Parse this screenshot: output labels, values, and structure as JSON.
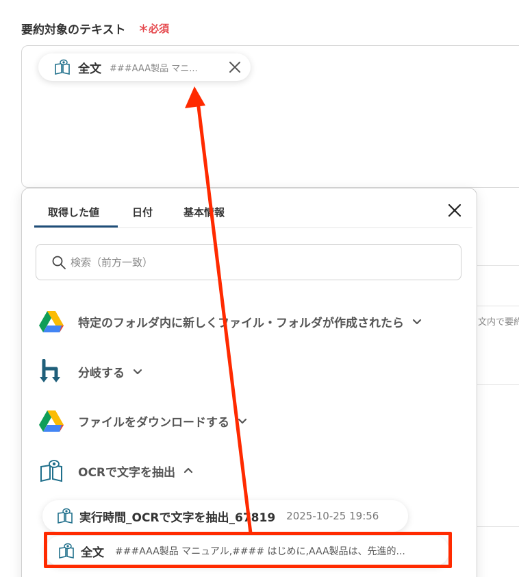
{
  "field": {
    "label": "要約対象のテキスト",
    "required": "＊必須"
  },
  "chip": {
    "icon": "book-eye-icon",
    "title": "全文",
    "preview": "###AAA製品 マニ..."
  },
  "background": {
    "partial_text": "文内で要約"
  },
  "panel": {
    "tabs": [
      {
        "label": "取得した値",
        "active": true
      },
      {
        "label": "日付",
        "active": false
      },
      {
        "label": "基本情報",
        "active": false
      }
    ],
    "search": {
      "placeholder": "検索（前方一致）"
    },
    "steps": [
      {
        "icon": "google-drive-icon",
        "label": "特定のフォルダ内に新しくファイル・フォルダが作成されたら",
        "expanded": false
      },
      {
        "icon": "branch-icon",
        "label": "分岐する",
        "expanded": false
      },
      {
        "icon": "google-drive-icon",
        "label": "ファイルをダウンロードする",
        "expanded": false
      },
      {
        "icon": "book-eye-icon",
        "label": "OCRで文字を抽出",
        "expanded": true
      }
    ],
    "results": [
      {
        "icon": "book-eye-icon",
        "title": "実行時間_OCRで文字を抽出_67819",
        "meta": "2025-10-25 19:56"
      },
      {
        "icon": "book-eye-icon",
        "title": "全文",
        "meta": "###AAA製品 マニュアル,#### はじめに,AAA製品は、先進的..."
      }
    ]
  },
  "colors": {
    "accent": "#1f4e79",
    "required": "#e5484d",
    "annotation": "#ff2a00",
    "icon": "#1f6f8b"
  }
}
